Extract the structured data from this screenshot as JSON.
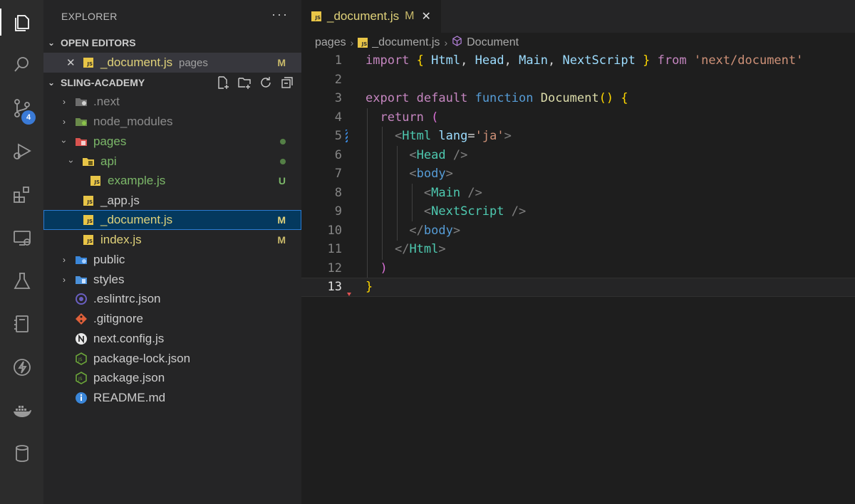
{
  "activity_bar": {
    "items": [
      {
        "icon": "files-icon",
        "active": true
      },
      {
        "icon": "search-icon"
      },
      {
        "icon": "source-control-icon",
        "badge": "4"
      },
      {
        "icon": "run-debug-icon"
      },
      {
        "icon": "extensions-icon"
      },
      {
        "icon": "remote-explorer-icon"
      },
      {
        "icon": "testing-icon"
      },
      {
        "icon": "notebook-icon"
      },
      {
        "icon": "lightning-icon"
      },
      {
        "icon": "docker-icon"
      },
      {
        "icon": "database-icon"
      }
    ]
  },
  "explorer": {
    "title": "EXPLORER",
    "more": "···",
    "open_editors": {
      "title": "OPEN EDITORS",
      "items": [
        {
          "close": "✕",
          "name": "_document.js",
          "folder": "pages",
          "status": "M"
        }
      ]
    },
    "project": {
      "title": "SLING-ACADEMY",
      "tree": [
        {
          "name": ".next",
          "kind": "folder",
          "expanded": false,
          "depth": 0
        },
        {
          "name": "node_modules",
          "kind": "folder",
          "expanded": false,
          "depth": 0
        },
        {
          "name": "pages",
          "kind": "folder",
          "expanded": true,
          "depth": 0,
          "dot": true
        },
        {
          "name": "api",
          "kind": "folder",
          "expanded": true,
          "depth": 1,
          "dot": true
        },
        {
          "name": "example.js",
          "kind": "js",
          "depth": 2,
          "status": "U"
        },
        {
          "name": "_app.js",
          "kind": "js",
          "depth": 1
        },
        {
          "name": "_document.js",
          "kind": "js",
          "depth": 1,
          "status": "M",
          "selected": true
        },
        {
          "name": "index.js",
          "kind": "js",
          "depth": 1,
          "status": "M"
        },
        {
          "name": "public",
          "kind": "folder",
          "expanded": false,
          "depth": 0
        },
        {
          "name": "styles",
          "kind": "folder",
          "expanded": false,
          "depth": 0
        },
        {
          "name": ".eslintrc.json",
          "kind": "eslint",
          "depth": 0
        },
        {
          "name": ".gitignore",
          "kind": "git",
          "depth": 0
        },
        {
          "name": "next.config.js",
          "kind": "next",
          "depth": 0
        },
        {
          "name": "package-lock.json",
          "kind": "node",
          "depth": 0
        },
        {
          "name": "package.json",
          "kind": "node",
          "depth": 0
        },
        {
          "name": "README.md",
          "kind": "info",
          "depth": 0
        }
      ]
    }
  },
  "editor": {
    "tab": {
      "name": "_document.js",
      "modified": "M",
      "close": "✕"
    },
    "breadcrumb": [
      "pages",
      "_document.js",
      "Document"
    ],
    "lines": [
      "1",
      "2",
      "3",
      "4",
      "5",
      "6",
      "7",
      "8",
      "9",
      "10",
      "11",
      "12",
      "13"
    ],
    "current_line": "13"
  },
  "colors": {
    "accent": "#2a7bd3",
    "modified": "#c8b96a",
    "untracked": "#7cb869",
    "folder_green": "#7cb869"
  }
}
